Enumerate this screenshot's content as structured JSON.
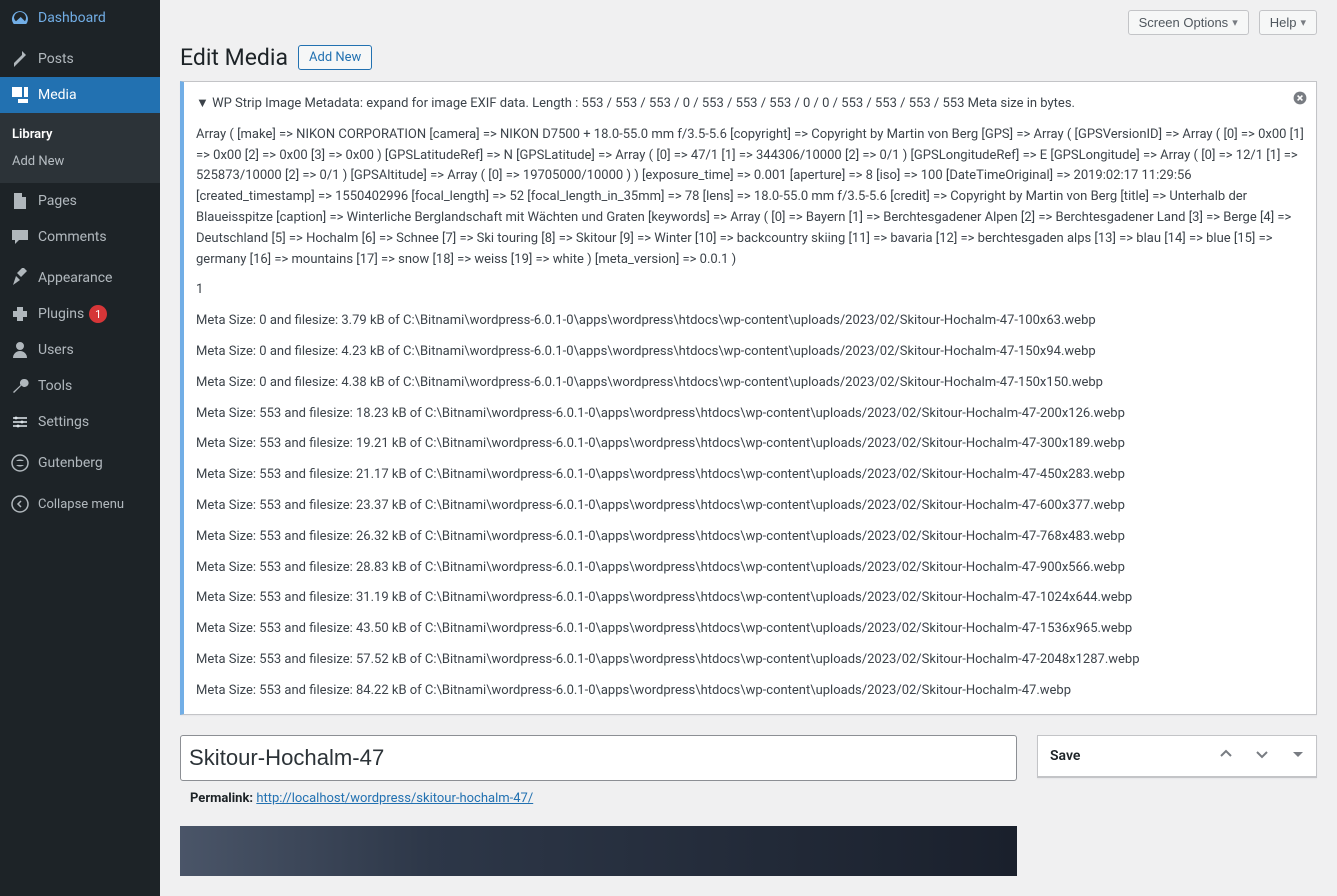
{
  "sidebar": {
    "items": [
      {
        "label": "Dashboard"
      },
      {
        "label": "Posts"
      },
      {
        "label": "Media"
      },
      {
        "label": "Pages"
      },
      {
        "label": "Comments"
      },
      {
        "label": "Appearance"
      },
      {
        "label": "Plugins",
        "badge": "1"
      },
      {
        "label": "Users"
      },
      {
        "label": "Tools"
      },
      {
        "label": "Settings"
      },
      {
        "label": "Gutenberg"
      }
    ],
    "sub": [
      {
        "label": "Library"
      },
      {
        "label": "Add New"
      }
    ],
    "collapse": "Collapse menu"
  },
  "topbar": {
    "screen_options": "Screen Options",
    "help": "Help"
  },
  "page": {
    "title": "Edit Media",
    "add_new": "Add New"
  },
  "notice": {
    "summary": "▼ WP Strip Image Metadata: expand for image EXIF data. Length : 553 / 553 / 553 / 0 / 553 / 553 / 553 / 0 / 0 / 553 / 553 / 553 / 553 Meta size in bytes.",
    "exif": "Array ( [make] => NIKON CORPORATION [camera] => NIKON D7500 + 18.0-55.0 mm f/3.5-5.6 [copyright] => Copyright by Martin von Berg [GPS] => Array ( [GPSVersionID] => Array ( [0] => 0x00 [1] => 0x00 [2] => 0x00 [3] => 0x00 ) [GPSLatitudeRef] => N [GPSLatitude] => Array ( [0] => 47/1 [1] => 344306/10000 [2] => 0/1 ) [GPSLongitudeRef] => E [GPSLongitude] => Array ( [0] => 12/1 [1] => 525873/10000 [2] => 0/1 ) [GPSAltitude] => Array ( [0] => 19705000/10000 ) ) [exposure_time] => 0.001 [aperture] => 8 [iso] => 100 [DateTimeOriginal] => 2019:02:17 11:29:56 [created_timestamp] => 1550402996 [focal_length] => 52 [focal_length_in_35mm] => 78 [lens] => 18.0-55.0 mm f/3.5-5.6 [credit] => Copyright by Martin von Berg [title] => Unterhalb der Blaueisspitze [caption] => Winterliche Berglandschaft mit Wächten und Graten [keywords] => Array ( [0] => Bayern [1] => Berchtesgadener Alpen [2] => Berchtesgadener Land [3] => Berge [4] => Deutschland [5] => Hochalm [6] => Schnee [7] => Ski touring [8] => Skitour [9] => Winter [10] => backcountry skiing [11] => bavaria [12] => berchtesgaden alps [13] => blau [14] => blue [15] => germany [16] => mountains [17] => snow [18] => weiss [19] => white ) [meta_version] => 0.0.1 )",
    "count": "1",
    "lines": [
      "Meta Size: 0 and filesize: 3.79 kB of C:\\Bitnami\\wordpress-6.0.1-0\\apps\\wordpress\\htdocs\\wp-content\\uploads/2023/02/Skitour-Hochalm-47-100x63.webp",
      "Meta Size: 0 and filesize: 4.23 kB of C:\\Bitnami\\wordpress-6.0.1-0\\apps\\wordpress\\htdocs\\wp-content\\uploads/2023/02/Skitour-Hochalm-47-150x94.webp",
      "Meta Size: 0 and filesize: 4.38 kB of C:\\Bitnami\\wordpress-6.0.1-0\\apps\\wordpress\\htdocs\\wp-content\\uploads/2023/02/Skitour-Hochalm-47-150x150.webp",
      "Meta Size: 553 and filesize: 18.23 kB of C:\\Bitnami\\wordpress-6.0.1-0\\apps\\wordpress\\htdocs\\wp-content\\uploads/2023/02/Skitour-Hochalm-47-200x126.webp",
      "Meta Size: 553 and filesize: 19.21 kB of C:\\Bitnami\\wordpress-6.0.1-0\\apps\\wordpress\\htdocs\\wp-content\\uploads/2023/02/Skitour-Hochalm-47-300x189.webp",
      "Meta Size: 553 and filesize: 21.17 kB of C:\\Bitnami\\wordpress-6.0.1-0\\apps\\wordpress\\htdocs\\wp-content\\uploads/2023/02/Skitour-Hochalm-47-450x283.webp",
      "Meta Size: 553 and filesize: 23.37 kB of C:\\Bitnami\\wordpress-6.0.1-0\\apps\\wordpress\\htdocs\\wp-content\\uploads/2023/02/Skitour-Hochalm-47-600x377.webp",
      "Meta Size: 553 and filesize: 26.32 kB of C:\\Bitnami\\wordpress-6.0.1-0\\apps\\wordpress\\htdocs\\wp-content\\uploads/2023/02/Skitour-Hochalm-47-768x483.webp",
      "Meta Size: 553 and filesize: 28.83 kB of C:\\Bitnami\\wordpress-6.0.1-0\\apps\\wordpress\\htdocs\\wp-content\\uploads/2023/02/Skitour-Hochalm-47-900x566.webp",
      "Meta Size: 553 and filesize: 31.19 kB of C:\\Bitnami\\wordpress-6.0.1-0\\apps\\wordpress\\htdocs\\wp-content\\uploads/2023/02/Skitour-Hochalm-47-1024x644.webp",
      "Meta Size: 553 and filesize: 43.50 kB of C:\\Bitnami\\wordpress-6.0.1-0\\apps\\wordpress\\htdocs\\wp-content\\uploads/2023/02/Skitour-Hochalm-47-1536x965.webp",
      "Meta Size: 553 and filesize: 57.52 kB of C:\\Bitnami\\wordpress-6.0.1-0\\apps\\wordpress\\htdocs\\wp-content\\uploads/2023/02/Skitour-Hochalm-47-2048x1287.webp",
      "Meta Size: 553 and filesize: 84.22 kB of C:\\Bitnami\\wordpress-6.0.1-0\\apps\\wordpress\\htdocs\\wp-content\\uploads/2023/02/Skitour-Hochalm-47.webp"
    ]
  },
  "media": {
    "title": "Skitour-Hochalm-47",
    "permalink_label": "Permalink:",
    "permalink": "http://localhost/wordpress/skitour-hochalm-47/"
  },
  "savebox": {
    "title": "Save"
  }
}
